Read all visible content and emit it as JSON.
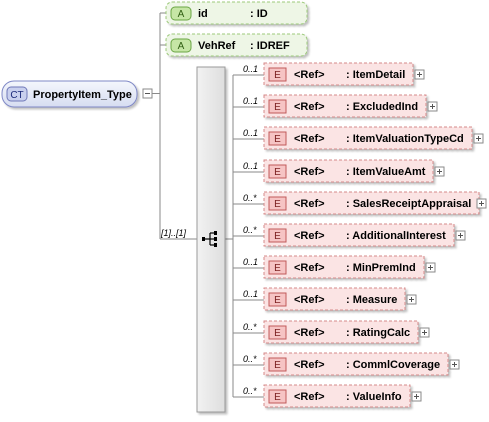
{
  "root": {
    "badge": "CT",
    "label": "PropertyItem_Type",
    "expander": "−"
  },
  "attributes": [
    {
      "badge": "A",
      "name": "id",
      "type": ": ID"
    },
    {
      "badge": "A",
      "name": "VehRef",
      "type": ": IDREF"
    }
  ],
  "sequence": {
    "cardinality": "[1]..[1]",
    "icon": "sequence-icon"
  },
  "elements": [
    {
      "badge": "E",
      "ref": "<Ref>",
      "name": ": ItemDetail",
      "cardinality": "0..1",
      "optional": true,
      "expander": "+"
    },
    {
      "badge": "E",
      "ref": "<Ref>",
      "name": ": ExcludedInd",
      "cardinality": "0..1",
      "optional": true,
      "expander": "+"
    },
    {
      "badge": "E",
      "ref": "<Ref>",
      "name": ": ItemValuationTypeCd",
      "cardinality": "0..1",
      "optional": true,
      "expander": "+"
    },
    {
      "badge": "E",
      "ref": "<Ref>",
      "name": ": ItemValueAmt",
      "cardinality": "0..1",
      "optional": true,
      "expander": "+"
    },
    {
      "badge": "E",
      "ref": "<Ref>",
      "name": ": SalesReceiptAppraisal",
      "cardinality": "0..*",
      "optional": true,
      "expander": "+"
    },
    {
      "badge": "E",
      "ref": "<Ref>",
      "name": ": AdditionalInterest",
      "cardinality": "0..*",
      "optional": true,
      "expander": "+"
    },
    {
      "badge": "E",
      "ref": "<Ref>",
      "name": ": MinPremInd",
      "cardinality": "0..1",
      "optional": true,
      "expander": "+"
    },
    {
      "badge": "E",
      "ref": "<Ref>",
      "name": ": Measure",
      "cardinality": "0..1",
      "optional": true,
      "expander": "+"
    },
    {
      "badge": "E",
      "ref": "<Ref>",
      "name": ": RatingCalc",
      "cardinality": "0..*",
      "optional": true,
      "expander": "+"
    },
    {
      "badge": "E",
      "ref": "<Ref>",
      "name": ": CommlCoverage",
      "cardinality": "0..*",
      "optional": true,
      "expander": "+"
    },
    {
      "badge": "E",
      "ref": "<Ref>",
      "name": ": ValueInfo",
      "cardinality": "0..*",
      "optional": true,
      "expander": "+"
    }
  ],
  "colors": {
    "root_fill": "#e4e8f6",
    "root_stroke": "#7f88c6",
    "attr_fill": "#eef6e6",
    "attr_stroke": "#9cc97a",
    "attr_badge_fill": "#c6e6a6",
    "elem_fill": "#fbe4e4",
    "elem_stroke": "#d68a8a",
    "elem_badge_fill": "#f6c4c4",
    "seq_fill": "#e9e9e9",
    "seq_stroke": "#9a9a9a",
    "line": "#8a8a8a",
    "text": "#000000"
  }
}
